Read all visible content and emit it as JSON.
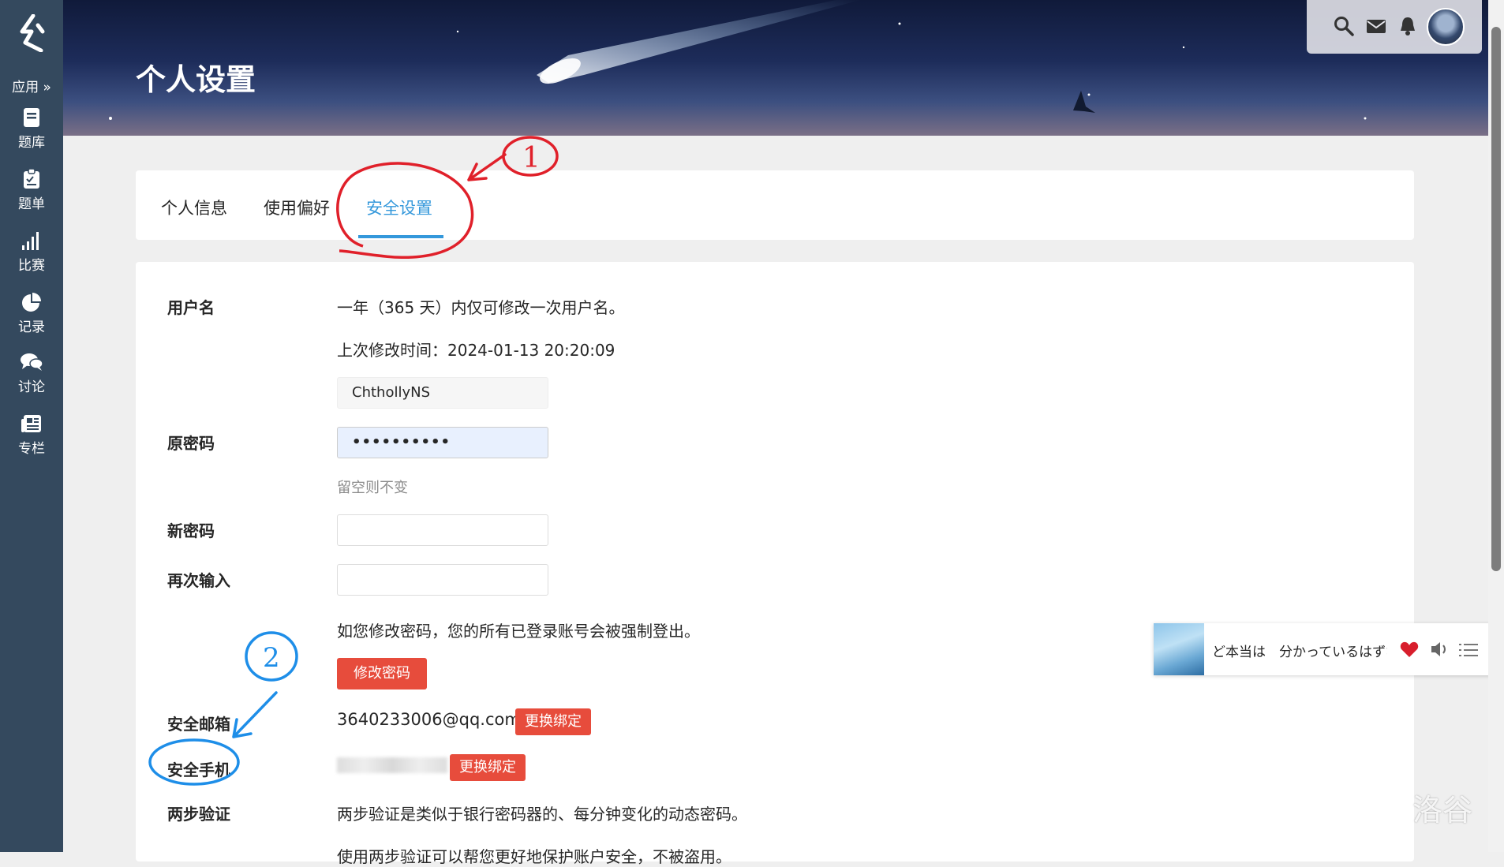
{
  "sidebar": {
    "apps_label": "应用",
    "items": [
      {
        "label": "题库",
        "icon": "book-icon"
      },
      {
        "label": "题单",
        "icon": "clipboard-icon"
      },
      {
        "label": "比赛",
        "icon": "bar-chart-icon"
      },
      {
        "label": "记录",
        "icon": "pie-chart-icon"
      },
      {
        "label": "讨论",
        "icon": "comments-icon"
      },
      {
        "label": "专栏",
        "icon": "newspaper-icon"
      }
    ]
  },
  "header": {
    "title": "个人设置",
    "icons": [
      "search-icon",
      "envelope-icon",
      "bell-icon",
      "avatar"
    ]
  },
  "tabs": [
    {
      "label": "个人信息"
    },
    {
      "label": "使用偏好"
    },
    {
      "label": "安全设置",
      "active": true
    }
  ],
  "settings": {
    "username": {
      "label": "用户名",
      "note": "一年（365 天）内仅可修改一次用户名。",
      "last_modified": "上次修改时间：2024-01-13 20:20:09",
      "value": "ChthollyNS"
    },
    "old_password": {
      "label": "原密码",
      "value": "••••••••••",
      "hint": "留空则不变"
    },
    "new_password": {
      "label": "新密码",
      "value": ""
    },
    "repeat_password": {
      "label": "再次输入",
      "value": ""
    },
    "password_warning": "如您修改密码，您的所有已登录账号会被强制登出。",
    "change_password_button": "修改密码",
    "email": {
      "label": "安全邮箱",
      "value": "3640233006@qq.com",
      "button": "更换绑定"
    },
    "phone": {
      "label": "安全手机",
      "button": "更换绑定"
    },
    "two_factor": {
      "label": "两步验证",
      "desc": "两步验证是类似于银行密码器的、每分钟变化的动态密码。",
      "desc2": "使用两步验证可以帮您更好地保护账户安全，不被盗用。"
    }
  },
  "music_player": {
    "song": "ど本当は　分かっているはずなのに"
  },
  "watermark": "洛谷",
  "annotations": [
    "1",
    "2"
  ],
  "colors": {
    "sidebar": "#34495e",
    "accent": "#3498db",
    "danger": "#e74c3c",
    "annot_red": "#e0202a",
    "annot_blue": "#1e8ee8"
  }
}
